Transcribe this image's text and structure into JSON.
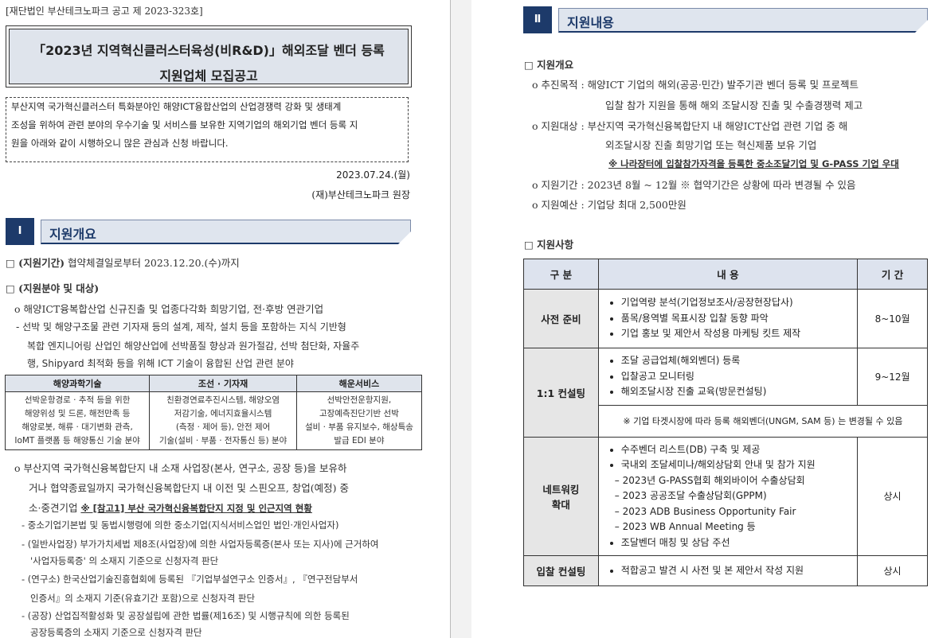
{
  "left": {
    "notice_no": "[재단법인 부산테크노파크 공고 제 2023-323호]",
    "title_line1": "「2023년 지역혁신클러스터육성(비R&D)」해외조달 벤더 등록",
    "title_line2": "지원업체 모집공고",
    "intro_lines": [
      " 부산지역 국가혁신클러스터 특화분야인 해양ICT융합산업의 산업경쟁력 강화 및 생태계",
      "조성을 위하여 관련 분야의 우수기술 및 서비스를 보유한 지역기업의 해외기업 벤더 등록 지",
      "원을 아래와 같이 시행하오니 많은 관심과 신청 바랍니다."
    ],
    "date": "2023.07.24.(월)",
    "org": "(재)부산테크노파크 원장",
    "section_num": "Ⅰ",
    "section_title": "지원개요",
    "period_label": "□ (지원기간)",
    "period_text": " 협약체결일로부터 2023.12.20.(수)까지",
    "field_label": "□ (지원분야 및 대상)",
    "field_o1": "o 해양ICT융복합산업 신규진출 및 업종다각화 희망기업, 전·후방 연관기업",
    "field_d1_l1": "- 선박 및 해양구조물 관련 기자재 등의 설계, 제작, 설치 등을 포함하는 지식 기반형",
    "field_d1_l2": "복합 엔지니어링 산업인 해양산업에 선박품질 향상과 원가절감, 선박 첨단화, 자율주",
    "field_d1_l3": "행, Shipyard 최적화 등을 위해 ICT 기술이 융합된 산업 관련 분야",
    "table1": {
      "headers": [
        "해양과학기술",
        "조선 · 기자재",
        "해운서비스"
      ],
      "col1": [
        "선박운항경로 · 추적 등을 위한",
        "해양위성 및 드론, 해전만족 등",
        "해양로봇, 해류 · 대기변화 관측,",
        "IoMT 플랫폼 등 해양통신 기술 분야"
      ],
      "col2": [
        "친환경연료추진시스템, 해양오염",
        "저감기술, 에너지효율시스템",
        "(측정 · 제어 등), 안전 제어",
        "기술(설비 · 부품 · 전자통신 등) 분야"
      ],
      "col3": [
        "선박안전운항지원,",
        "고장예측진단기반 선박",
        "설비 · 부품 유지보수, 해상특송",
        "발급 EDI 분야"
      ]
    },
    "o2_l1": "o 부산지역 국가혁신융복합단지 내 소재 사업장(본사, 연구소, 공장 등)을 보유하",
    "o2_l2": "거나 협약종료일까지 국가혁신융복합단지 내 이전 및 스핀오프, 창업(예정) 중",
    "o2_l3a": "소·중견기업 ",
    "o2_l3b": "※ [참고1] 부산 국가혁신융복합단지 지정 및 인근지역 현황",
    "d2": "- 중소기업기본법 및 동법시행령에 의한 중소기업(지식서비스업인 법인·개인사업자)",
    "d3_l1": "- (일반사업장) 부가가치세법 제8조(사업장)에 의한 사업자등록증(본사 또는 지사)에 근거하여",
    "d3_l2": "'사업자등록증' 의 소재지 기준으로 신청자격 판단",
    "d4_l1": "- (연구소) 한국산업기술진흥협회에 등록된 『기업부설연구소 인증서』, 『연구전담부서",
    "d4_l2": "인증서』의 소재지 기준(유효기간 포함)으로 신청자격 판단",
    "d5_l1": "- (공장) 산업집적활성화 및 공장설립에 관한 법률(제16조) 및 시행규칙에 의한 등록된",
    "d5_l2": "공장등록증의 소재지 기준으로 신청자격 판단"
  },
  "right": {
    "section_num": "Ⅱ",
    "section_title": "지원내용",
    "overview_label": "□ 지원개요",
    "purpose_l1": "o 추진목적 : 해양ICT 기업의 해외(공공·민간) 발주기관 벤더 등록 및 프로젝트",
    "purpose_l2": "입찰 참가 지원을 통해 해외 조달시장 진출 및 수출경쟁력 제고",
    "target_l1": "o 지원대상 : 부산지역 국가혁신융복합단지 내 해양ICT산업 관련 기업 중 해",
    "target_l2": "외조달시장 진출 희망기업 또는 혁신제품 보유 기업",
    "target_note": "※ 나라장터에 입찰참가자격을 등록한 중소조달기업 및 G-PASS 기업 우대",
    "period": "o 지원기간 : 2023년 8월 ~ 12월   ※ 협약기간은 상황에 따라 변경될 수 있음",
    "budget": "o 지원예산 : 기업당 최대 2,500만원",
    "details_label": "□ 지원사항",
    "table": {
      "h_cat": "구 분",
      "h_content": "내 용",
      "h_period": "기 간",
      "r1_cat": "사전 준비",
      "r1_items": [
        "기업역량 분석(기업정보조사/공장현장답사)",
        "품목/용역별 목표시장 입찰 동향 파악",
        "기업 홍보 및 제안서 작성용 마케팅 킷트 제작"
      ],
      "r1_period": "8~10월",
      "r2_cat": "1:1 컨설팅",
      "r2_items": [
        "조달 공급업체(해외벤더) 등록",
        "입찰공고 모니터링",
        "해외조달시장 진출 교육(방문컨설팅)"
      ],
      "r2_period": "9~12월",
      "r2_note": "※ 기업 타겟시장에 따라 등록 해외벤더(UNGM, SAM 등) 는 변경될 수 있음",
      "r3_cat_l1": "네트워킹",
      "r3_cat_l2": "확대",
      "r3_items": [
        "수주벤더 리스트(DB) 구축 및 제공",
        "국내외 조달세미나/해외상담회 안내 및 참가 지원"
      ],
      "r3_sub": [
        "– 2023년 G-PASS협회 해외바이어 수출상담회",
        "– 2023 공공조달 수출상담회(GPPM)",
        "– 2023 ADB Business Opportunity Fair",
        "– 2023 WB Annual Meeting 등"
      ],
      "r3_last": "조달벤더 매칭 및 상담 주선",
      "r3_period": "상시",
      "r4_cat": "입찰 컨설팅",
      "r4_item": "적합공고 발견 시 사전 및 본 제안서 작성 지원",
      "r4_period": "상시"
    }
  }
}
